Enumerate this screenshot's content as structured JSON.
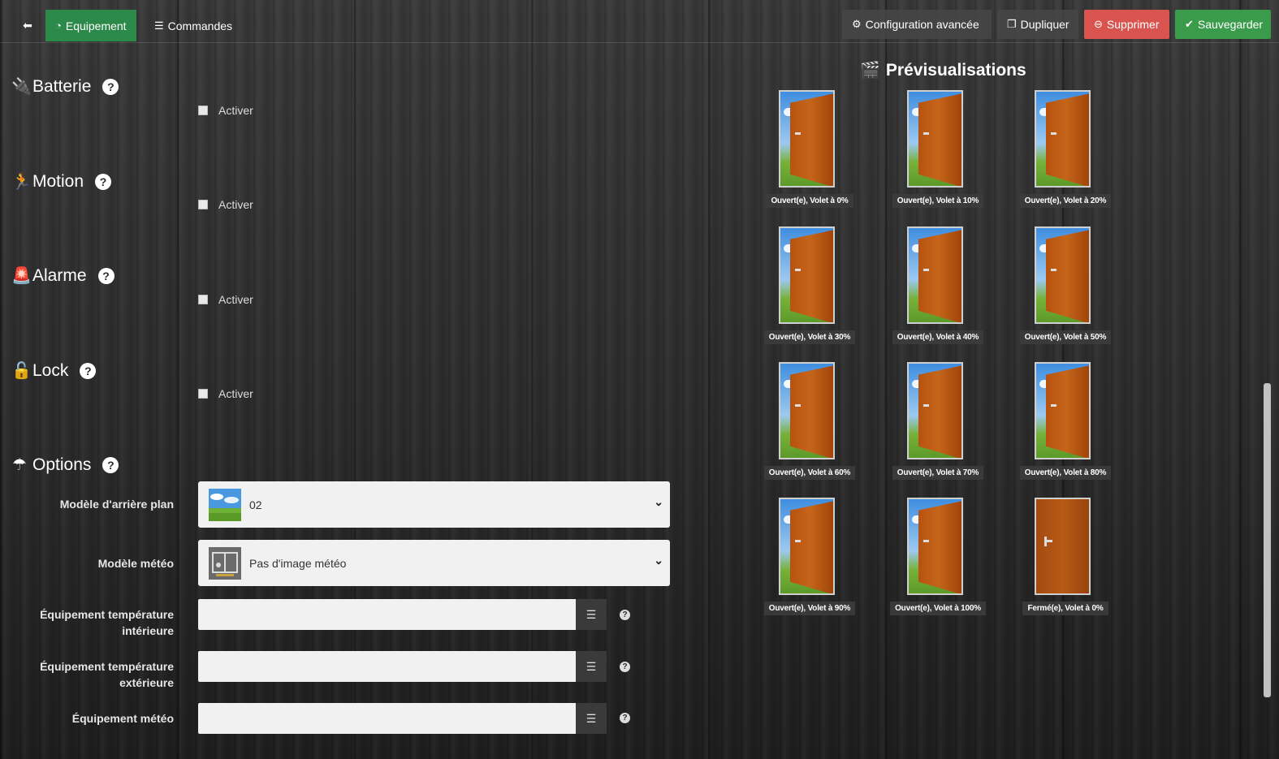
{
  "tabs": {
    "equipement": "Equipement",
    "commandes": "Commandes"
  },
  "actions": {
    "config": "Configuration avancée",
    "dupliquer": "Dupliquer",
    "supprimer": "Supprimer",
    "sauvegarder": "Sauvegarder"
  },
  "sections": {
    "batterie": {
      "title": "Batterie",
      "checkbox": "Activer"
    },
    "motion": {
      "title": "Motion",
      "checkbox": "Activer"
    },
    "alarme": {
      "title": "Alarme",
      "checkbox": "Activer"
    },
    "lock": {
      "title": "Lock",
      "checkbox": "Activer"
    },
    "options": {
      "title": "Options"
    }
  },
  "form": {
    "background_label": "Modèle d'arrière plan",
    "background_value": "02",
    "meteo_label": "Modèle météo",
    "meteo_value": "Pas d'image météo",
    "temp_int_label_1": "Équipement température",
    "temp_int_label_2": "intérieure",
    "temp_ext_label_1": "Équipement température",
    "temp_ext_label_2": "extérieure",
    "meteo_eq_label": "Équipement météo"
  },
  "preview": {
    "title": "Prévisualisations",
    "items": [
      "Ouvert(e), Volet à 0%",
      "Ouvert(e), Volet à 10%",
      "Ouvert(e), Volet à 20%",
      "Ouvert(e), Volet à 30%",
      "Ouvert(e), Volet à 40%",
      "Ouvert(e), Volet à 50%",
      "Ouvert(e), Volet à 60%",
      "Ouvert(e), Volet à 70%",
      "Ouvert(e), Volet à 80%",
      "Ouvert(e), Volet à 90%",
      "Ouvert(e), Volet à 100%",
      "Fermé(e), Volet à 0%"
    ]
  },
  "colors": {
    "equip_tab": "#2b8a4a",
    "delete": "#d9534f",
    "save": "#3a9b4b"
  },
  "icons": [
    "back-arrow-icon",
    "dashboard-icon",
    "list-icon",
    "gears-icon",
    "copy-icon",
    "minus-circle-icon",
    "check-circle-icon",
    "plug-icon",
    "running-icon",
    "alarm-icon",
    "lock-icon",
    "umbrella-icon",
    "clapperboard-icon",
    "list-button-icon",
    "help-icon"
  ]
}
